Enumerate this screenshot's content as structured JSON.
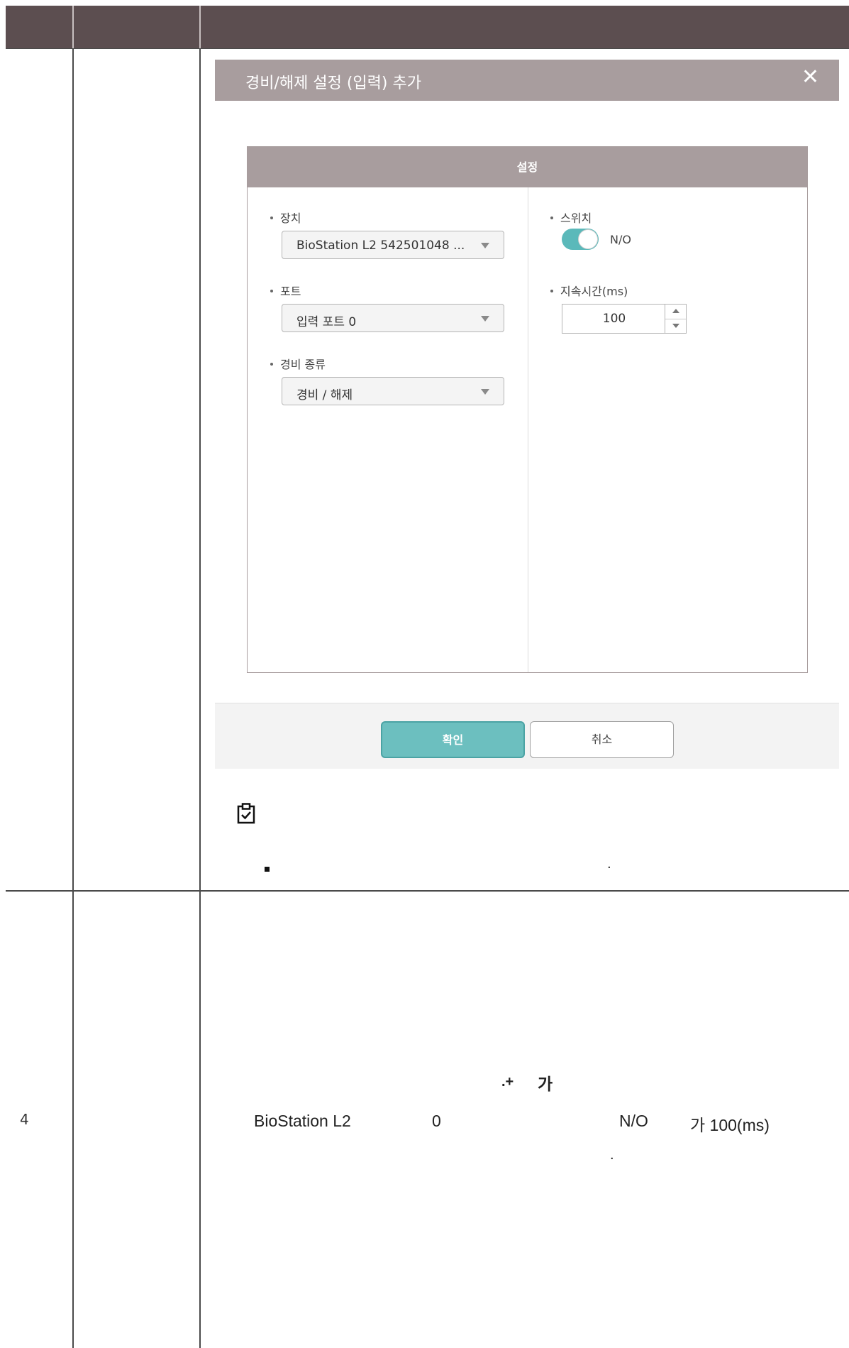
{
  "dialog": {
    "title": "경비/해제 설정 (입력) 추가",
    "close_glyph": "✕",
    "panel_header": "설정",
    "fields": {
      "device": {
        "label": "장치",
        "value": "BioStation L2 542501048 ..."
      },
      "port": {
        "label": "포트",
        "value": "입력 포트 0"
      },
      "alarm_type": {
        "label": "경비 종류",
        "value": "경비 / 해제"
      },
      "switch": {
        "label": "스위치",
        "value": "N/O",
        "on": true
      },
      "duration": {
        "label": "지속시간(ms)",
        "value": "100"
      }
    },
    "buttons": {
      "ok": "확인",
      "cancel": "취소"
    }
  },
  "note": {
    "period": "."
  },
  "row4": {
    "number": "4",
    "line1_a": ".+",
    "line1_b": "가",
    "line2_device": "BioStation L2",
    "line2_port": "0",
    "line2_switch": "N/O",
    "line2_duration": "가 100(ms)",
    "line3": "."
  },
  "colors": {
    "header": "#5c4e50",
    "dialog_title": "#a89d9e",
    "accent": "#6cbfbf",
    "toggle_on": "#5bb9ba"
  }
}
